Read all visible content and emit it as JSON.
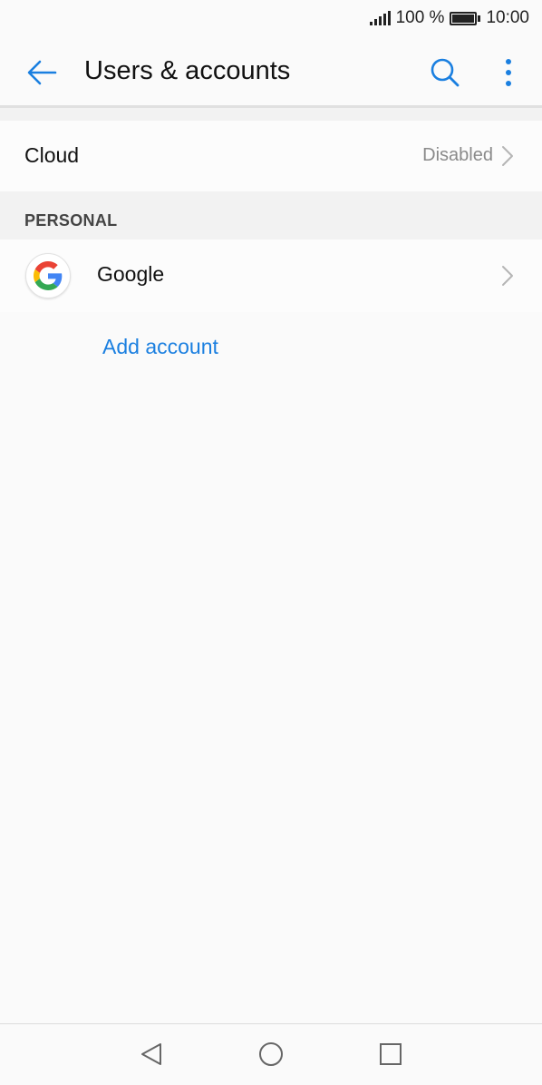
{
  "status_bar": {
    "battery_text": "100 %",
    "time": "10:00"
  },
  "header": {
    "title": "Users & accounts"
  },
  "cloud": {
    "label": "Cloud",
    "status": "Disabled"
  },
  "personal_section": {
    "title": "PERSONAL",
    "accounts": [
      {
        "label": "Google",
        "icon": "google-logo-icon"
      }
    ],
    "add_account_label": "Add account"
  },
  "colors": {
    "accent": "#1a7fe0",
    "background": "#fafafa",
    "section_background": "#f2f2f2"
  },
  "nav_bar": {
    "icons": [
      "nav-back-icon",
      "nav-home-icon",
      "nav-recents-icon"
    ]
  }
}
